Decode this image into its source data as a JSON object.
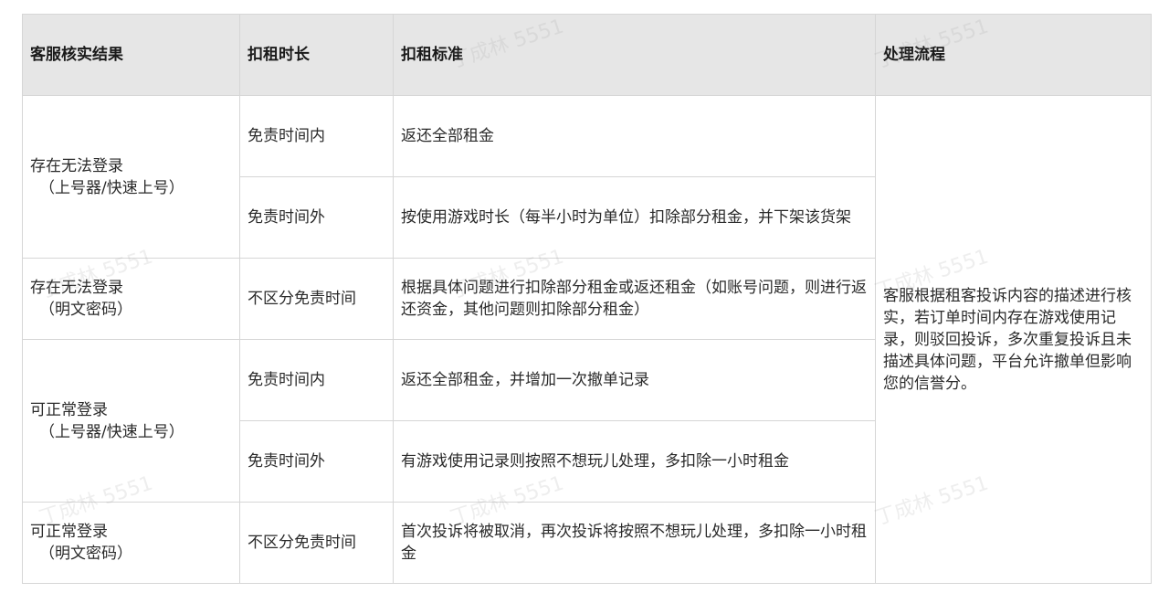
{
  "header": {
    "col1": "客服核实结果",
    "col2": "扣租时长",
    "col3": "扣租标准",
    "col4": "处理流程"
  },
  "rows": [
    {
      "result_line1": "存在无法登录",
      "result_line2": "（上号器/快速上号）",
      "duration": "免责时间内",
      "standard": "返还全部租金"
    },
    {
      "duration": "免责时间外",
      "standard": "按使用游戏时长（每半小时为单位）扣除部分租金，并下架该货架"
    },
    {
      "result_line1": "存在无法登录",
      "result_line2": "（明文密码）",
      "duration": "不区分免责时间",
      "standard": "根据具体问题进行扣除部分租金或返还租金（如账号问题，则进行返还资金，其他问题则扣除部分租金）"
    },
    {
      "result_line1": "可正常登录",
      "result_line2": "（上号器/快速上号）",
      "duration": "免责时间内",
      "standard": "返还全部租金，并增加一次撤单记录"
    },
    {
      "duration": "免责时间外",
      "standard": "有游戏使用记录则按照不想玩儿处理，多扣除一小时租金"
    },
    {
      "result_line1": "可正常登录",
      "result_line2": "（明文密码）",
      "duration": "不区分免责时间",
      "standard": "首次投诉将被取消，再次投诉将按照不想玩儿处理，多扣除一小时租金"
    }
  ],
  "process": "客服根据租客投诉内容的描述进行核实，若订单时间内存在游戏使用记录，则驳回投诉，多次重复投诉且未描述具体问题，平台允许撤单但影响您的信誉分。",
  "watermark": "丁成林 5551"
}
